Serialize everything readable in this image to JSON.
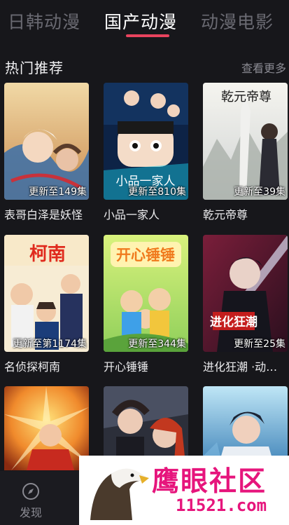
{
  "tabs": [
    {
      "label": "日韩动漫",
      "active": false
    },
    {
      "label": "国产动漫",
      "active": true
    },
    {
      "label": "动漫电影",
      "active": false
    }
  ],
  "section": {
    "title": "热门推荐",
    "more": "查看更多"
  },
  "items": [
    {
      "title": "表哥白泽是妖怪",
      "badge": "更新至149集",
      "cover_text": "表哥白泽是妖怪"
    },
    {
      "title": "小品一家人",
      "badge": "更新至810集",
      "cover_text": "小品一家人"
    },
    {
      "title": "乾元帝尊",
      "badge": "更新至39集",
      "cover_text": "乾元帝尊"
    },
    {
      "title": "名侦探柯南",
      "badge": "更新至第1174集",
      "cover_text": "柯南"
    },
    {
      "title": "开心锤锤",
      "badge": "更新至344集",
      "cover_text": "开心锤锤"
    },
    {
      "title": "进化狂潮 ·动…",
      "badge": "更新至25集",
      "cover_text": "进化狂潮"
    },
    {
      "title": "",
      "badge": "",
      "cover_text": ""
    },
    {
      "title": "",
      "badge": "",
      "cover_text": ""
    },
    {
      "title": "",
      "badge": "",
      "cover_text": ""
    }
  ],
  "bottom_nav": {
    "discover_label": "发现",
    "discover_icon": "compass-icon"
  },
  "watermark": {
    "text": "鹰眼社区",
    "url": "11521.com"
  },
  "colors": {
    "accent": "#e8435e",
    "background": "#17171b",
    "watermark": "#e6157c"
  }
}
